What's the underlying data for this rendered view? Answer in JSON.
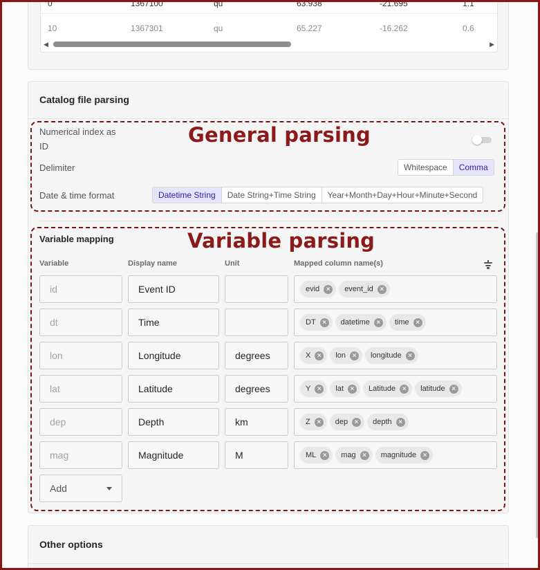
{
  "table": {
    "rows": [
      [
        "0",
        "1367100",
        "qu",
        "63.938",
        "-21.695",
        "1.1"
      ],
      [
        "10",
        "1367301",
        "qu",
        "65.227",
        "-16.262",
        "0.6"
      ]
    ],
    "scroll_left_arrow": "◀",
    "scroll_right_arrow": "▶"
  },
  "catalog": {
    "title": "Catalog file parsing",
    "general_overlay": "General parsing",
    "variable_overlay": "Variable parsing",
    "numerical_index_label_line1": "Numerical index as",
    "numerical_index_label_line2": "ID",
    "numerical_index_on": false,
    "delimiter_label": "Delimiter",
    "delimiter_options": [
      "Whitespace",
      "Comma"
    ],
    "delimiter_selected": "Comma",
    "datetime_label": "Date & time format",
    "datetime_options": [
      "Datetime String",
      "Date String+Time String",
      "Year+Month+Day+Hour+Minute+Second"
    ],
    "datetime_selected": "Datetime String",
    "variable_mapping_title": "Variable mapping",
    "columns": {
      "variable": "Variable",
      "display_name": "Display name",
      "unit": "Unit",
      "mapped": "Mapped column name(s)"
    },
    "variables": [
      {
        "variable": "id",
        "display": "Event ID",
        "unit": "",
        "mapped": [
          "evid",
          "event_id"
        ]
      },
      {
        "variable": "dt",
        "display": "Time",
        "unit": "",
        "mapped": [
          "DT",
          "datetime",
          "time"
        ]
      },
      {
        "variable": "lon",
        "display": "Longitude",
        "unit": "degrees",
        "mapped": [
          "X",
          "lon",
          "longitude"
        ]
      },
      {
        "variable": "lat",
        "display": "Latitude",
        "unit": "degrees",
        "mapped": [
          "Y",
          "lat",
          "Latitude",
          "latitude"
        ]
      },
      {
        "variable": "dep",
        "display": "Depth",
        "unit": "km",
        "mapped": [
          "Z",
          "dep",
          "depth"
        ]
      },
      {
        "variable": "mag",
        "display": "Magnitude",
        "unit": "M",
        "mapped": [
          "ML",
          "mag",
          "magnitude"
        ]
      }
    ],
    "add_label": "Add"
  },
  "other_options": {
    "title": "Other options"
  },
  "colors": {
    "accent_active_bg": "#e6e4fb",
    "accent_active_text": "#2b1fa8",
    "annotation": "#8b1a1a"
  }
}
